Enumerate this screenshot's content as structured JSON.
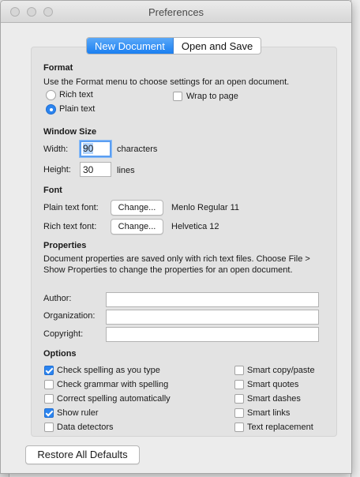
{
  "window": {
    "title": "Preferences"
  },
  "tabs": [
    {
      "label": "New Document",
      "active": true
    },
    {
      "label": "Open and Save",
      "active": false
    }
  ],
  "format": {
    "heading": "Format",
    "description": "Use the Format menu to choose settings for an open document.",
    "rich_text_label": "Rich text",
    "plain_text_label": "Plain text",
    "selected": "Plain text",
    "wrap_label": "Wrap to page",
    "wrap_checked": false
  },
  "window_size": {
    "heading": "Window Size",
    "width_label": "Width:",
    "width_value": "90",
    "width_unit": "characters",
    "height_label": "Height:",
    "height_value": "30",
    "height_unit": "lines"
  },
  "font": {
    "heading": "Font",
    "plain_label": "Plain text font:",
    "plain_button": "Change...",
    "plain_value": "Menlo Regular 11",
    "rich_label": "Rich text font:",
    "rich_button": "Change...",
    "rich_value": "Helvetica 12"
  },
  "properties": {
    "heading": "Properties",
    "description": "Document properties are saved only with rich text files. Choose File > Show Properties to change the properties for an open document.",
    "author_label": "Author:",
    "organization_label": "Organization:",
    "copyright_label": "Copyright:",
    "author_value": "",
    "organization_value": "",
    "copyright_value": ""
  },
  "options": {
    "heading": "Options",
    "left": [
      {
        "label": "Check spelling as you type",
        "checked": true
      },
      {
        "label": "Check grammar with spelling",
        "checked": false
      },
      {
        "label": "Correct spelling automatically",
        "checked": false
      },
      {
        "label": "Show ruler",
        "checked": true
      },
      {
        "label": "Data detectors",
        "checked": false
      }
    ],
    "right": [
      {
        "label": "Smart copy/paste",
        "checked": false
      },
      {
        "label": "Smart quotes",
        "checked": false
      },
      {
        "label": "Smart dashes",
        "checked": false
      },
      {
        "label": "Smart links",
        "checked": false
      },
      {
        "label": "Text replacement",
        "checked": false
      }
    ]
  },
  "footer": {
    "restore_label": "Restore All Defaults"
  },
  "colors": {
    "accent": "#2b84ef",
    "window_bg": "#ececec",
    "panel_bg": "#e3e3e3"
  }
}
